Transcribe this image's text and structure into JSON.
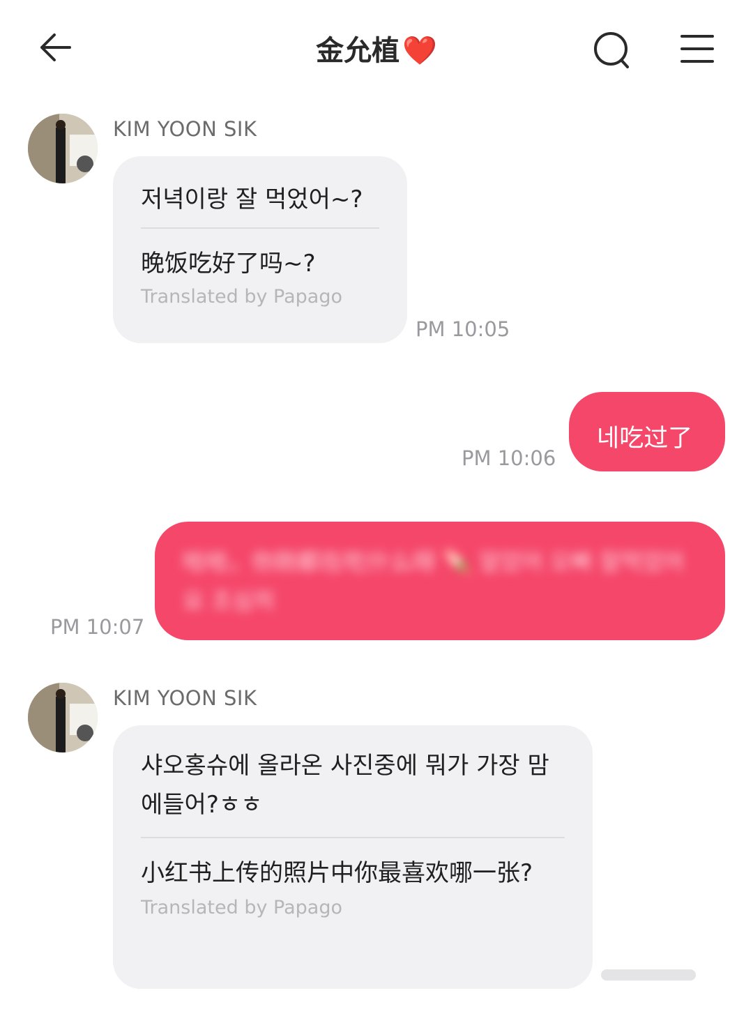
{
  "header": {
    "title": "金允植",
    "title_emoji": "❤️",
    "back_icon": "arrow-left-icon",
    "search_icon": "search-icon",
    "menu_icon": "hamburger-menu-icon"
  },
  "messages": [
    {
      "direction": "incoming",
      "sender": "KIM YOON SIK",
      "original": "저녁이랑 잘 먹었어~?",
      "translation": "晚饭吃好了吗~?",
      "credit": "Translated by Papago",
      "time": "PM 10:05"
    },
    {
      "direction": "outgoing",
      "text": "네吃过了",
      "time": "PM 10:06"
    },
    {
      "direction": "outgoing",
      "text": "哈哈，你刚都在吃什么呀 🍡 알았어 오빠 잘먹었어요 조심히",
      "blurred": true,
      "time": "PM 10:07"
    },
    {
      "direction": "incoming",
      "sender": "KIM YOON SIK",
      "original": "샤오홍슈에 올라온 사진중에 뭐가 가장 맘에들어?ㅎㅎ",
      "translation": "小红书上传的照片中你最喜欢哪一张?",
      "credit": "Translated by Papago",
      "time": ""
    }
  ],
  "colors": {
    "outgoing_bubble": "#f5476a",
    "incoming_bubble": "#f1f1f3",
    "timestamp": "#9a9a9e"
  }
}
